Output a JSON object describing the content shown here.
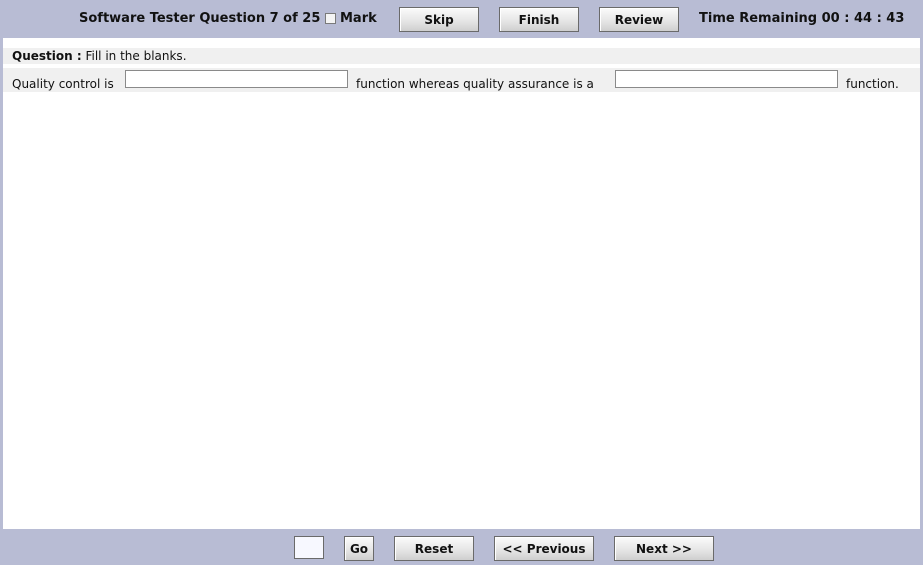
{
  "header": {
    "title": "Software Tester Question 7 of 25",
    "mark_label": "Mark",
    "skip_label": "Skip",
    "finish_label": "Finish",
    "review_label": "Review",
    "time_remaining": "Time Remaining 00 : 44 : 43"
  },
  "question": {
    "label": "Question :",
    "prompt": "Fill in the blanks.",
    "parts": [
      "Quality control is",
      "function whereas quality assurance is a",
      "function."
    ],
    "blanks": [
      "",
      ""
    ]
  },
  "footer": {
    "page_input_value": "",
    "go_label": "Go",
    "reset_label": "Reset",
    "previous_label": "<< Previous",
    "next_label": "Next >>"
  }
}
